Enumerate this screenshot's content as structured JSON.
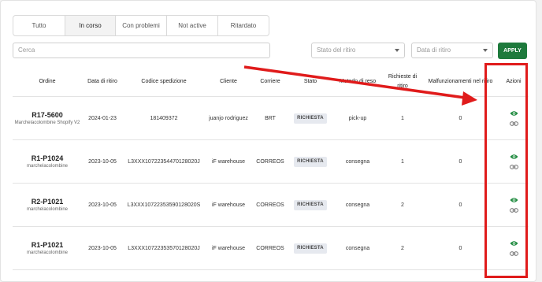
{
  "tabs": [
    {
      "label": "Tutto"
    },
    {
      "label": "In corso"
    },
    {
      "label": "Con problemi"
    },
    {
      "label": "Not active"
    },
    {
      "label": "Ritardato"
    }
  ],
  "search": {
    "placeholder": "Cerca"
  },
  "filters": {
    "stato_placeholder": "Stato del ritiro",
    "data_placeholder": "Data di ritiro",
    "apply_label": "APPLY"
  },
  "table": {
    "headers": [
      "Ordine",
      "Data di ritiro",
      "Codice spedizione",
      "Cliente",
      "Corriere",
      "Stato",
      "Metodo di reso",
      "Richieste di ritiro",
      "Malfunzionamenti nel ritiro",
      "Azioni"
    ],
    "rows": [
      {
        "order": "R17-5600",
        "shop": "Marchelacolombine Shopify V2",
        "date": "2024-01-23",
        "code": "181409372",
        "client": "juanjo rodriguez",
        "carrier": "BRT",
        "status": "RICHIESTA",
        "method": "pick-up",
        "requests": "1",
        "malfunctions": "0"
      },
      {
        "order": "R1-P1024",
        "shop": "marchelacolombine",
        "date": "2023-10-05",
        "code": "L3XXX10722354470128020J",
        "client": "iF warehouse",
        "carrier": "CORREOS",
        "status": "RICHIESTA",
        "method": "consegna",
        "requests": "1",
        "malfunctions": "0"
      },
      {
        "order": "R2-P1021",
        "shop": "marchelacolombine",
        "date": "2023-10-05",
        "code": "L3XXX10722353590128020S",
        "client": "iF warehouse",
        "carrier": "CORREOS",
        "status": "RICHIESTA",
        "method": "consegna",
        "requests": "2",
        "malfunctions": "0"
      },
      {
        "order": "R1-P1021",
        "shop": "marchelacolombine",
        "date": "2023-10-05",
        "code": "L3XXX10722353570128020J",
        "client": "iF warehouse",
        "carrier": "CORREOS",
        "status": "RICHIESTA",
        "method": "consegna",
        "requests": "2",
        "malfunctions": "0"
      }
    ]
  },
  "icons": {
    "view": "eye-icon",
    "link": "link-icon"
  },
  "colors": {
    "accent": "#1e7a3c",
    "annotation": "#e01b1b"
  }
}
